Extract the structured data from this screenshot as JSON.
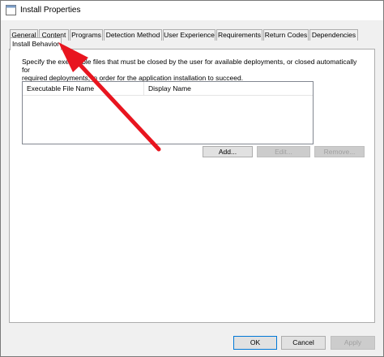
{
  "window": {
    "title": "Install Properties"
  },
  "tabs": [
    {
      "label": "General"
    },
    {
      "label": "Content"
    },
    {
      "label": "Programs"
    },
    {
      "label": "Detection Method"
    },
    {
      "label": "User Experience"
    },
    {
      "label": "Requirements"
    },
    {
      "label": "Return Codes"
    },
    {
      "label": "Dependencies"
    },
    {
      "label": "Install Behavior"
    }
  ],
  "active_tab": "Install Behavior",
  "install_behavior": {
    "description_line1": "Specify the executable files that must be closed by the user for available deployments, or closed automatically for",
    "description_line2": "required deployments, in order for the application installation to succeed.",
    "columns": [
      "Executable File Name",
      "Display Name"
    ],
    "rows": [],
    "add_label": "Add...",
    "edit_label": "Edit...",
    "remove_label": "Remove..."
  },
  "footer": {
    "ok_label": "OK",
    "cancel_label": "Cancel",
    "apply_label": "Apply"
  },
  "colors": {
    "annotation_arrow": "#e8151f",
    "default_button_border": "#0078d7"
  }
}
